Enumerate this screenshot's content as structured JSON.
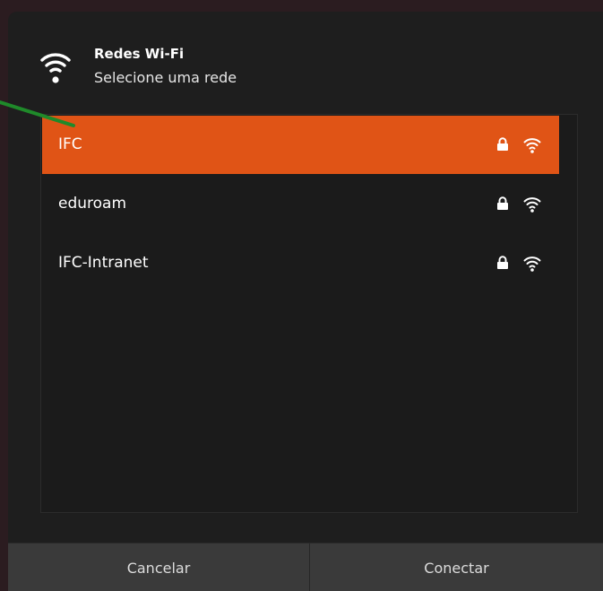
{
  "header": {
    "title": "Redes Wi-Fi",
    "subtitle": "Selecione uma rede",
    "icon": "wifi-icon"
  },
  "networks": [
    {
      "name": "IFC",
      "selected": true,
      "secured": true,
      "lock_icon": "lock-icon",
      "signal_icon": "wifi-signal-icon"
    },
    {
      "name": "eduroam",
      "selected": false,
      "secured": true,
      "lock_icon": "lock-icon",
      "signal_icon": "wifi-signal-icon"
    },
    {
      "name": "IFC-Intranet",
      "selected": false,
      "secured": true,
      "lock_icon": "lock-icon",
      "signal_icon": "wifi-signal-icon"
    }
  ],
  "footer": {
    "cancel_label": "Cancelar",
    "connect_label": "Conectar"
  },
  "colors": {
    "accent": "#e05416",
    "dialog_bg": "#1e1e1e",
    "footer_bg": "#3a3a3a",
    "annotation_arrow": "#1f8a2a"
  }
}
